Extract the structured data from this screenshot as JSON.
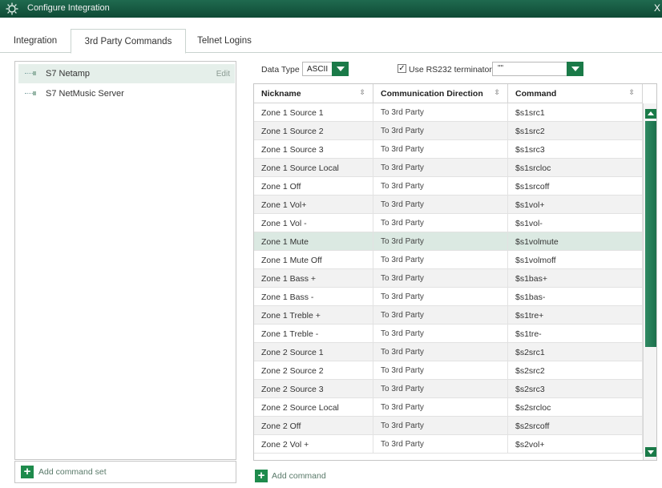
{
  "window": {
    "title": "Configure Integration",
    "close_glyph": "X",
    "icon": "gear-logo-icon"
  },
  "tabs": [
    {
      "label": "Integration"
    },
    {
      "label": "3rd Party Commands",
      "active": true
    },
    {
      "label": "Telnet Logins"
    }
  ],
  "command_sets": [
    {
      "name": "S7 Netamp",
      "selected": true,
      "edit_label": "Edit"
    },
    {
      "name": "S7 NetMusic Server"
    }
  ],
  "add_command_set_label": "Add command set",
  "toolbar": {
    "data_type_label": "Data Type",
    "data_type_value": "ASCII",
    "rs232_checked": true,
    "rs232_label": "Use RS232 terminator",
    "terminator_value": "\"\""
  },
  "grid": {
    "columns": [
      "Nickname",
      "Communication Direction",
      "Command"
    ],
    "sort_glyph": "⇳",
    "rows": [
      [
        "Zone 1 Source 1",
        "To 3rd Party",
        "$s1src1"
      ],
      [
        "Zone 1 Source 2",
        "To 3rd Party",
        "$s1src2"
      ],
      [
        "Zone 1 Source 3",
        "To 3rd Party",
        "$s1src3"
      ],
      [
        "Zone 1 Source Local",
        "To 3rd Party",
        "$s1srcloc"
      ],
      [
        "Zone 1 Off",
        "To 3rd Party",
        "$s1srcoff"
      ],
      [
        "Zone 1 Vol+",
        "To 3rd Party",
        "$s1vol+"
      ],
      [
        "Zone 1 Vol -",
        "To 3rd Party",
        "$s1vol-"
      ],
      [
        "Zone 1 Mute",
        "To 3rd Party",
        "$s1volmute"
      ],
      [
        "Zone 1 Mute Off",
        "To 3rd Party",
        "$s1volmoff"
      ],
      [
        "Zone 1 Bass +",
        "To 3rd Party",
        "$s1bas+"
      ],
      [
        "Zone 1 Bass -",
        "To 3rd Party",
        "$s1bas-"
      ],
      [
        "Zone 1 Treble +",
        "To 3rd Party",
        "$s1tre+"
      ],
      [
        "Zone 1 Treble -",
        "To 3rd Party",
        "$s1tre-"
      ],
      [
        "Zone 2 Source 1",
        "To 3rd Party",
        "$s2src1"
      ],
      [
        "Zone 2 Source 2",
        "To 3rd Party",
        "$s2src2"
      ],
      [
        "Zone 2 Source 3",
        "To 3rd Party",
        "$s2src3"
      ],
      [
        "Zone 2 Source Local",
        "To 3rd Party",
        "$s2srcloc"
      ],
      [
        "Zone 2 Off",
        "To 3rd Party",
        "$s2srcoff"
      ],
      [
        "Zone 2 Vol +",
        "To 3rd Party",
        "$s2vol+"
      ]
    ],
    "selected_row": 7
  },
  "add_command_label": "Add command",
  "colors": {
    "accent": "#1a7a48",
    "titlebar": "#12553c",
    "selected_row": "#dbe9e2"
  }
}
